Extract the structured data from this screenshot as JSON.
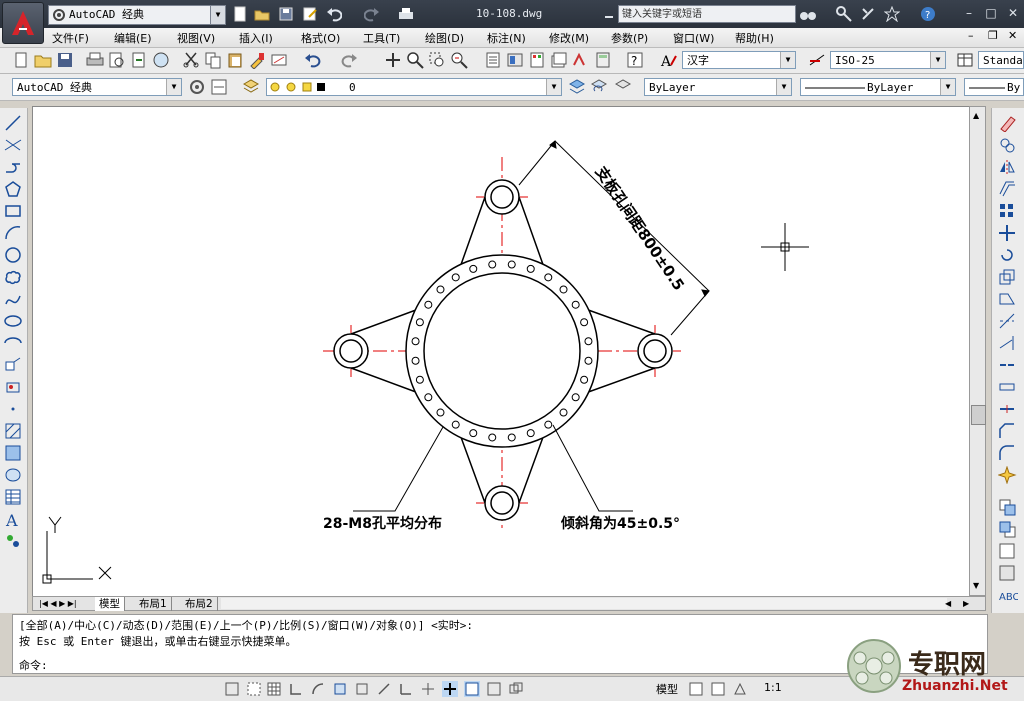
{
  "app": {
    "workspace": "AutoCAD 经典",
    "document_title": "10-108.dwg",
    "search_placeholder": "键入关键字或短语"
  },
  "menu": [
    "文件(F)",
    "编辑(E)",
    "视图(V)",
    "插入(I)",
    "格式(O)",
    "工具(T)",
    "绘图(D)",
    "标注(N)",
    "修改(M)",
    "参数(P)",
    "窗口(W)",
    "帮助(H)"
  ],
  "toolbars": {
    "text_style": "汉字",
    "dim_style": "ISO-25",
    "table_style": "Standa",
    "workspace_combo": "AutoCAD 经典",
    "layer": "0",
    "color": "ByLayer",
    "linetype": "ByLayer",
    "lineweight": "By"
  },
  "drawing": {
    "dim_label": "支板孔间距800±0.5",
    "hole_note": "28-M8孔平均分布",
    "angle_note": "倾斜角为45±0.5°",
    "ucs_y": "Y",
    "ucs_x": "X"
  },
  "tabs": [
    "模型",
    "布局1",
    "布局2"
  ],
  "command": {
    "line1": "[全部(A)/中心(C)/动态(D)/范围(E)/上一个(P)/比例(S)/窗口(W)/对象(O)] <实时>:",
    "line2": "按 Esc 或 Enter 键退出，或单击右键显示快捷菜单。",
    "prompt": "命令:"
  },
  "status": {
    "space": "模型",
    "scale": "1:1"
  },
  "watermark": {
    "text": "专职网",
    "url": "Zhuanzhi.Net"
  },
  "colors": {
    "title_bg": "#333a44",
    "center_line": "#e00000",
    "drawing_line": "#000000"
  }
}
